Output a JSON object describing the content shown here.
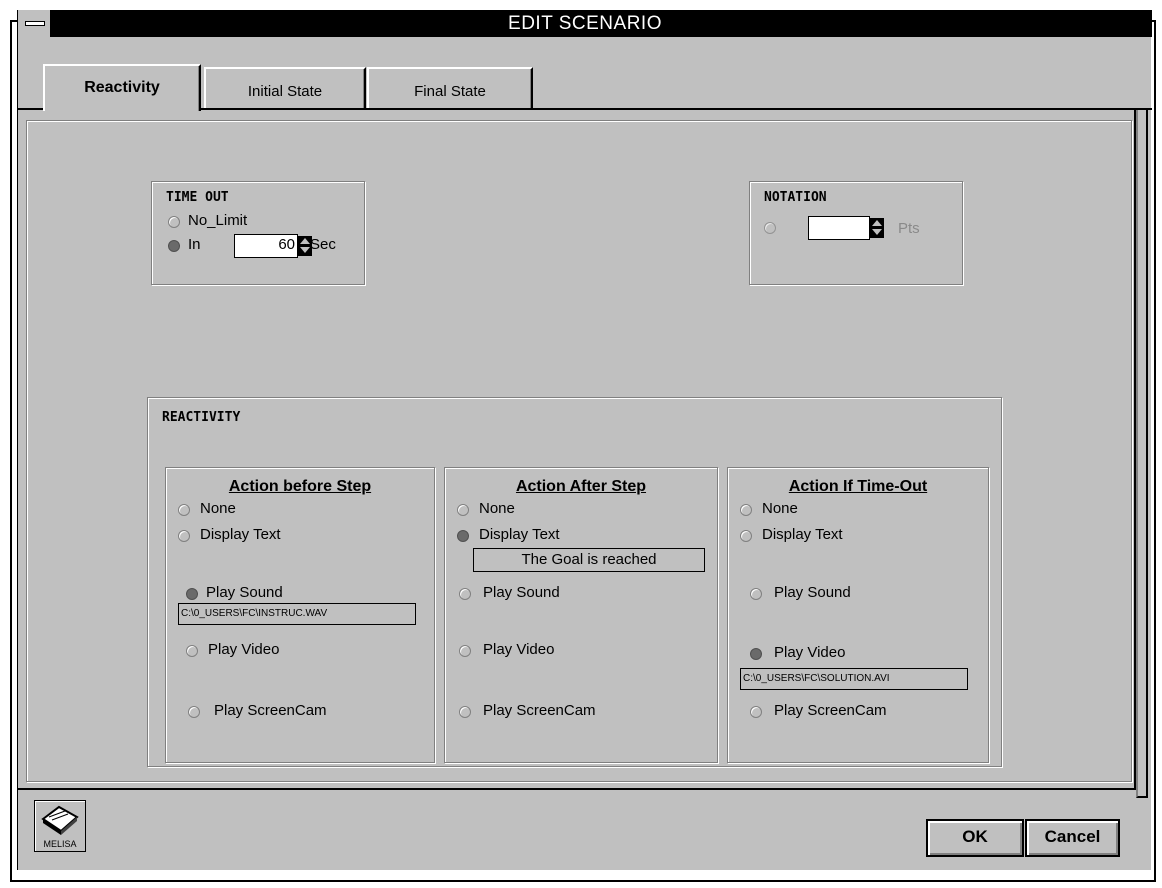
{
  "window": {
    "title": "EDIT SCENARIO"
  },
  "tabs": [
    {
      "label": "Reactivity",
      "active": true
    },
    {
      "label": "Initial State",
      "active": false
    },
    {
      "label": "Final State",
      "active": false
    }
  ],
  "timeout": {
    "title": "TIME OUT",
    "options": [
      {
        "label": "No_Limit",
        "selected": false
      },
      {
        "label": "In",
        "selected": true
      }
    ],
    "value": "60",
    "unit": "Sec"
  },
  "notation": {
    "title": "NOTATION",
    "value": "",
    "unit": "Pts",
    "enabled": false
  },
  "reactivity": {
    "title": "REACTIVITY",
    "columns": [
      {
        "heading": "Action before Step",
        "options": [
          "None",
          "Display Text",
          "Play Sound",
          "Play Video",
          "Play ScreenCam"
        ],
        "selected": "Play Sound",
        "path": "C:\\0_USERS\\FC\\INSTRUC.WAV"
      },
      {
        "heading": "Action After Step",
        "options": [
          "None",
          "Display Text",
          "Play Sound",
          "Play Video",
          "Play ScreenCam"
        ],
        "selected": "Display Text",
        "text": "The Goal is reached"
      },
      {
        "heading": "Action If Time-Out",
        "options": [
          "None",
          "Display Text",
          "Play Sound",
          "Play Video",
          "Play ScreenCam"
        ],
        "selected": "Play Video",
        "path": "C:\\0_USERS\\FC\\SOLUTION.AVI"
      }
    ]
  },
  "footer": {
    "logo_label": "MELISA",
    "ok_label": "OK",
    "cancel_label": "Cancel"
  },
  "colors": {
    "face": "#c0c0c0",
    "titlebar": "#000000",
    "radio_selected": "#6a6a6a"
  }
}
